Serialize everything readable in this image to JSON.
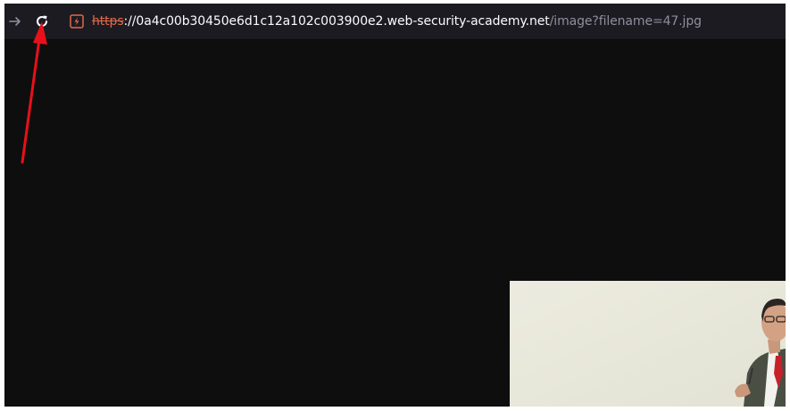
{
  "browser": {
    "forward_icon": "arrow-right-icon",
    "reload_icon": "reload-icon",
    "security_icon": "insecure-connection-icon",
    "url": {
      "scheme": "https",
      "separator": "://",
      "host": "0a4c00b30450e6d1c12a102c003900e2.web-security-academy.net",
      "path": "/image?filename=47.jpg"
    }
  },
  "colors": {
    "toolbar": "#1c1b22",
    "viewport": "#0e0e0f",
    "scheme_warning": "#e06a4a",
    "host_text": "#fbfbfe",
    "path_text": "#8f8f9d",
    "annotation_arrow": "#e8101a"
  },
  "content": {
    "image": "photo-of-man-in-suit-with-red-tie"
  }
}
